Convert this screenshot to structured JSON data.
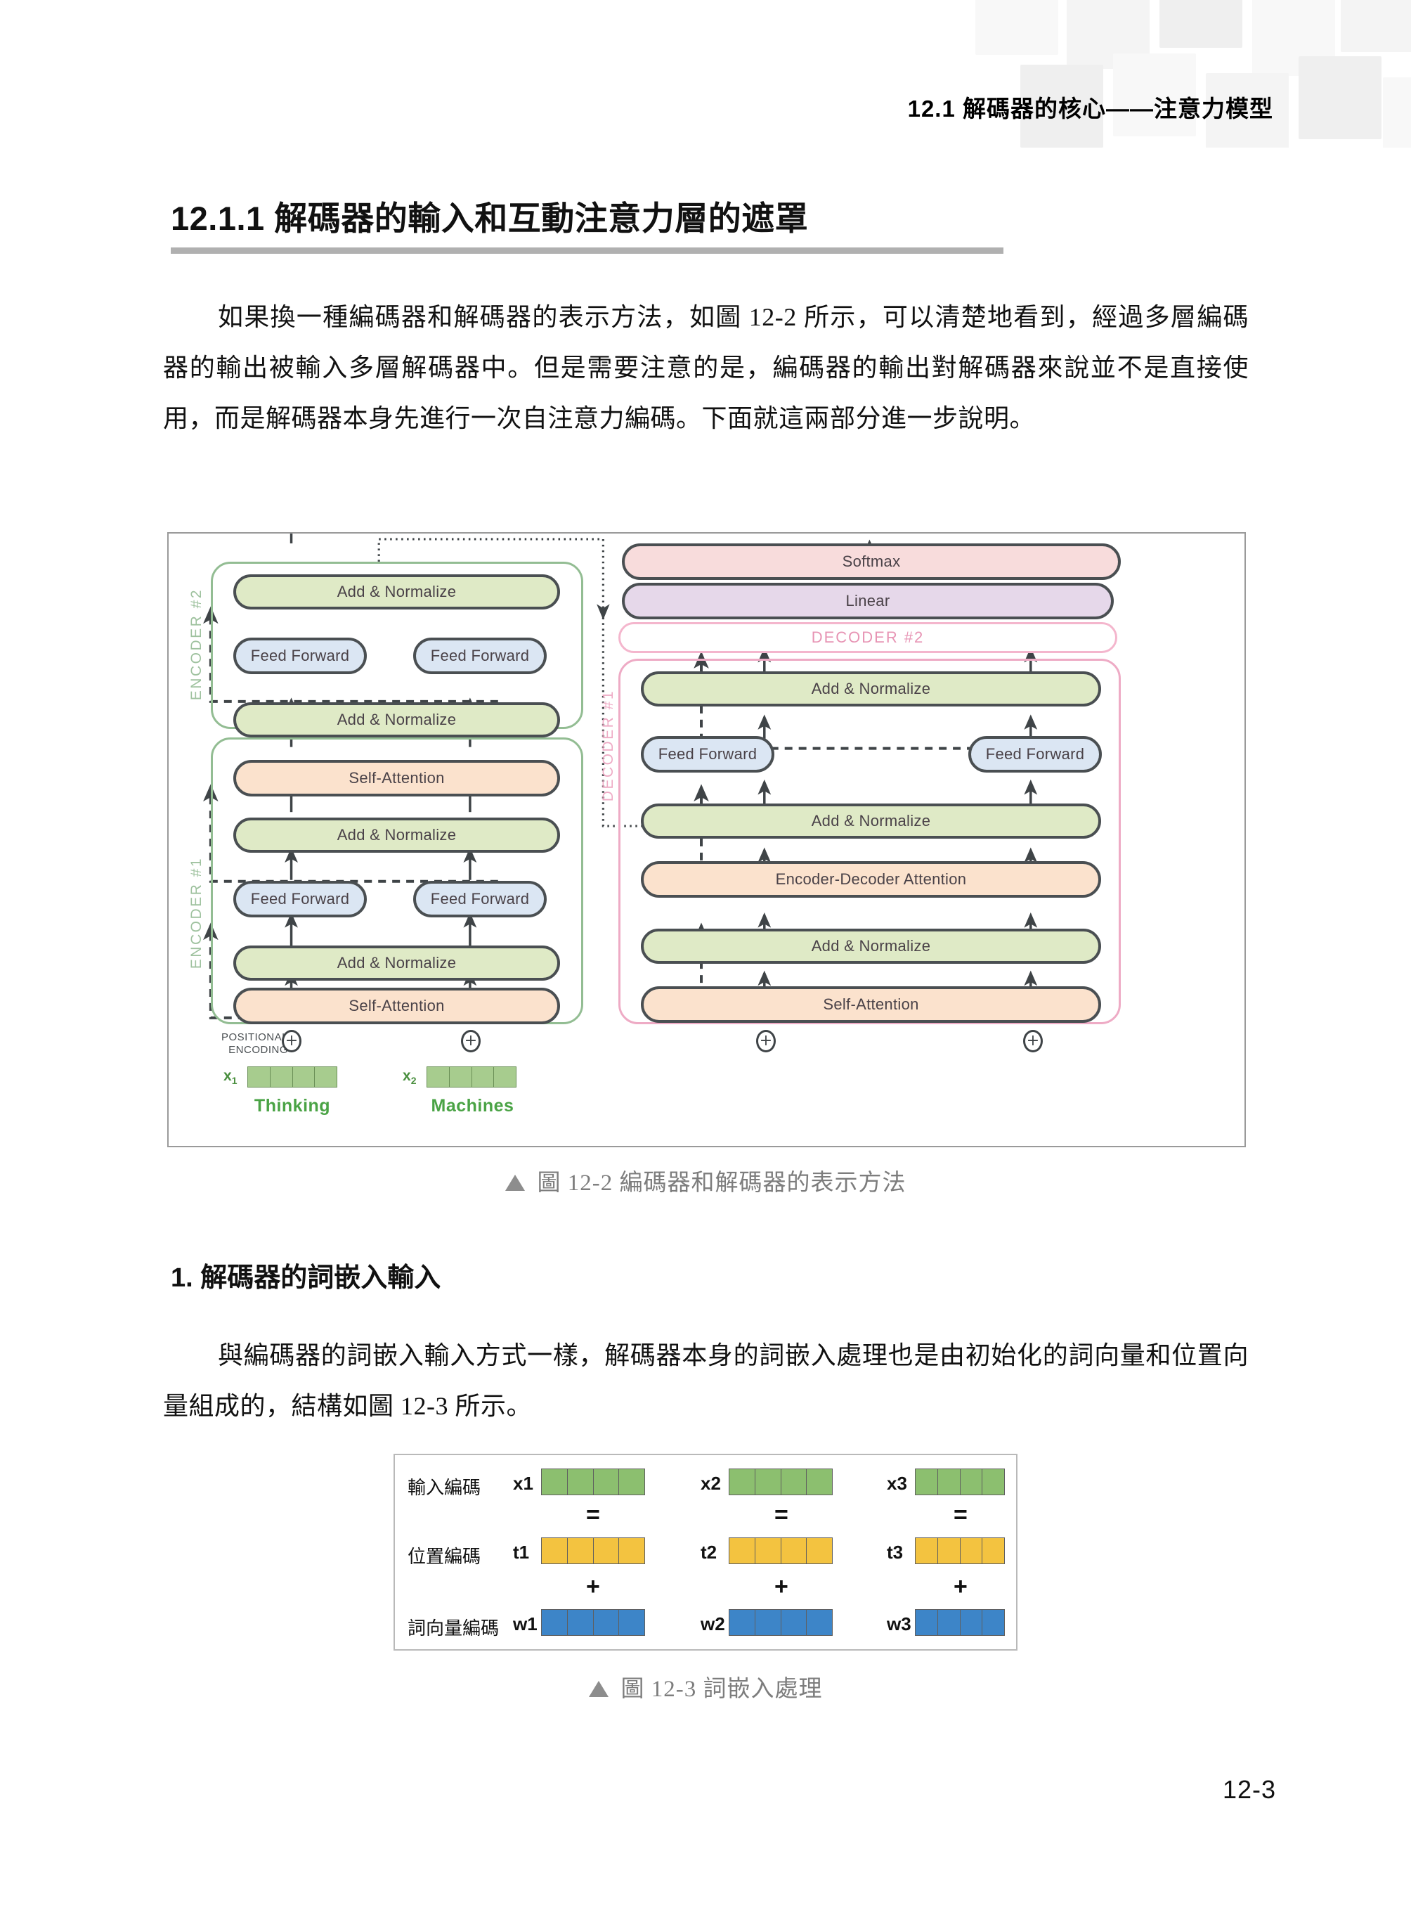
{
  "running_head": "12.1  解碼器的核心——注意力模型",
  "section_heading": "12.1.1  解碼器的輸入和互動注意力層的遮罩",
  "paragraphs": {
    "p1": "如果換一種編碼器和解碼器的表示方法，如圖 12-2 所示，可以清楚地看到，經過多層編碼器的輸出被輸入多層解碼器中。但是需要注意的是，編碼器的輸出對解碼器來說並不是直接使用，而是解碼器本身先進行一次自注意力編碼。下面就這兩部分進一步說明。",
    "p2": "與編碼器的詞嵌入輸入方式一樣，解碼器本身的詞嵌入處理也是由初始化的詞向量和位置向量組成的，結構如圖 12-3 所示。"
  },
  "subheading_1": "1.  解碼器的詞嵌入輸入",
  "captions": {
    "fig_12_2": "圖 12-2  編碼器和解碼器的表示方法",
    "fig_12_3": "圖 12-3  詞嵌入處理"
  },
  "page_number": "12-3",
  "figure_12_2": {
    "encoder": {
      "block_2_label": "ENCODER #2",
      "block_1_label": "ENCODER #1",
      "add_normalize": "Add & Normalize",
      "feed_forward": "Feed Forward",
      "self_attention": "Self-Attention"
    },
    "decoder": {
      "softmax": "Softmax",
      "linear": "Linear",
      "decoder_2_label": "DECODER #2",
      "decoder_1_label": "DECODER #1",
      "add_normalize": "Add & Normalize",
      "feed_forward": "Feed Forward",
      "encoder_decoder_attention": "Encoder-Decoder Attention",
      "self_attention": "Self-Attention"
    },
    "inputs": {
      "positional_encoding_line1": "POSITIONAL",
      "positional_encoding_line2": "ENCODING",
      "plus": "⊕",
      "x1_label": "x",
      "x1_sub": "1",
      "x2_label": "x",
      "x2_sub": "2",
      "word_1": "Thinking",
      "word_2": "Machines"
    },
    "colors": {
      "add_normalize": "#dfeac6",
      "feed_forward": "#dbe6f3",
      "attention": "#fbe2cd",
      "softmax": "#f8dcdc",
      "linear": "#e6d8ea",
      "encoder_border": "#93bd93",
      "decoder_border": "#eeabc5",
      "node_border": "#4a4f52",
      "embedding_green": "#a7cc8e",
      "word_text": "#4aa345"
    }
  },
  "figure_12_3": {
    "rows": [
      {
        "label": "輸入編碼",
        "color": "#8cbf6f",
        "cells": 4,
        "tags": [
          "x1",
          "x2",
          "x3"
        ]
      },
      {
        "label": "位置編碼",
        "color": "#f3c340",
        "cells": 4,
        "tags": [
          "t1",
          "t2",
          "t3"
        ]
      },
      {
        "label": "詞向量編碼",
        "color": "#3d85c8",
        "cells": 4,
        "tags": [
          "w1",
          "w2",
          "w3"
        ]
      }
    ],
    "operators": {
      "equals": "=",
      "plus": "+"
    }
  }
}
